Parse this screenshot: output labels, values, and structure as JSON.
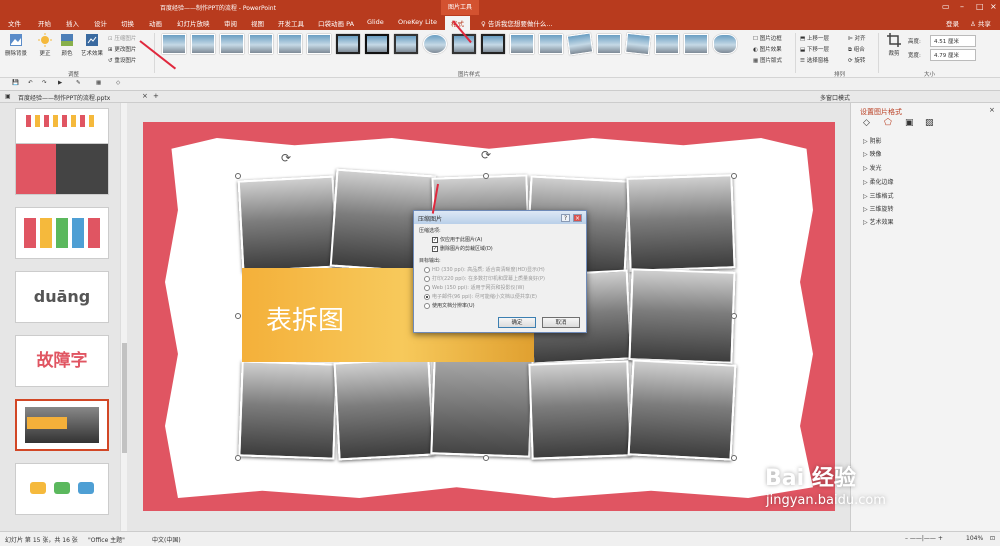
{
  "window": {
    "title": "百度经验——制作PPT的流程 - PowerPoint",
    "context_tab": "图片工具",
    "signin": "登录",
    "share": "共享"
  },
  "ribbon_tabs": [
    "文件",
    "开始",
    "插入",
    "设计",
    "切换",
    "动画",
    "幻灯片放映",
    "审阅",
    "视图",
    "开发工具",
    "口袋动画 PA",
    "Glide",
    "OneKey Lite",
    "格式"
  ],
  "tell_me": "告诉我您想要做什么...",
  "adjust": {
    "remove_bg": "删除背景",
    "corrections": "更正",
    "color": "颜色",
    "artistic": "艺术效果",
    "compress": "压缩图片",
    "change": "更改图片",
    "reset": "重设图片",
    "group": "调整"
  },
  "styles": {
    "group": "图片样式",
    "border": "图片边框",
    "effects": "图片效果",
    "layout": "图片版式"
  },
  "arrange": {
    "forward": "上移一层",
    "backward": "下移一层",
    "pane": "选择窗格",
    "align": "对齐",
    "group_btn": "组合",
    "rotate": "旋转",
    "group": "排列"
  },
  "size": {
    "crop": "裁剪",
    "height_label": "高度:",
    "height_value": "4.51 厘米",
    "width_label": "宽度:",
    "width_value": "4.79 厘米",
    "group": "大小"
  },
  "doc_tab": "百度经验——制作PPT的流程.pptx",
  "doc_option": "多窗口模式",
  "thumbnails": [
    {
      "num": "",
      "label": ""
    },
    {
      "num": "",
      "label": ""
    },
    {
      "num": "",
      "label": ""
    },
    {
      "num": "",
      "label": "duāng"
    },
    {
      "num": "",
      "label": "故障字"
    },
    {
      "num": "",
      "label": ""
    },
    {
      "num": "",
      "label": ""
    }
  ],
  "slide": {
    "title": "表拆图"
  },
  "dialog": {
    "title": "压缩图片",
    "options_header": "压缩选项:",
    "opt1": "仅应用于此图片(A)",
    "opt2": "删除图片的剪裁区域(D)",
    "target_header": "目标输出:",
    "t1": "HD (330 ppi): 高品质; 适合高清晰度(HD)显示(H)",
    "t2": "打印(220 ppi): 在多数打印机和屏幕上质量良好(P)",
    "t3": "Web (150 ppi): 适用于网页和投影仪(W)",
    "t4": "电子邮件(96 ppi): 尽可能缩小文档以便共享(E)",
    "t5": "使用文档分辨率(U)",
    "ok": "确定",
    "cancel": "取消"
  },
  "format_pane": {
    "title": "设置图片格式",
    "items": [
      "阴影",
      "映像",
      "发光",
      "柔化边缘",
      "三维格式",
      "三维旋转",
      "艺术效果"
    ]
  },
  "status": {
    "slide": "幻灯片 第 15 张，共 16 张",
    "theme": "\"Office 主题\"",
    "lang": "中文(中国)",
    "zoom": "104%"
  },
  "watermark": {
    "brand": "Bai 经验",
    "url": "jingyan.baidu.com"
  }
}
